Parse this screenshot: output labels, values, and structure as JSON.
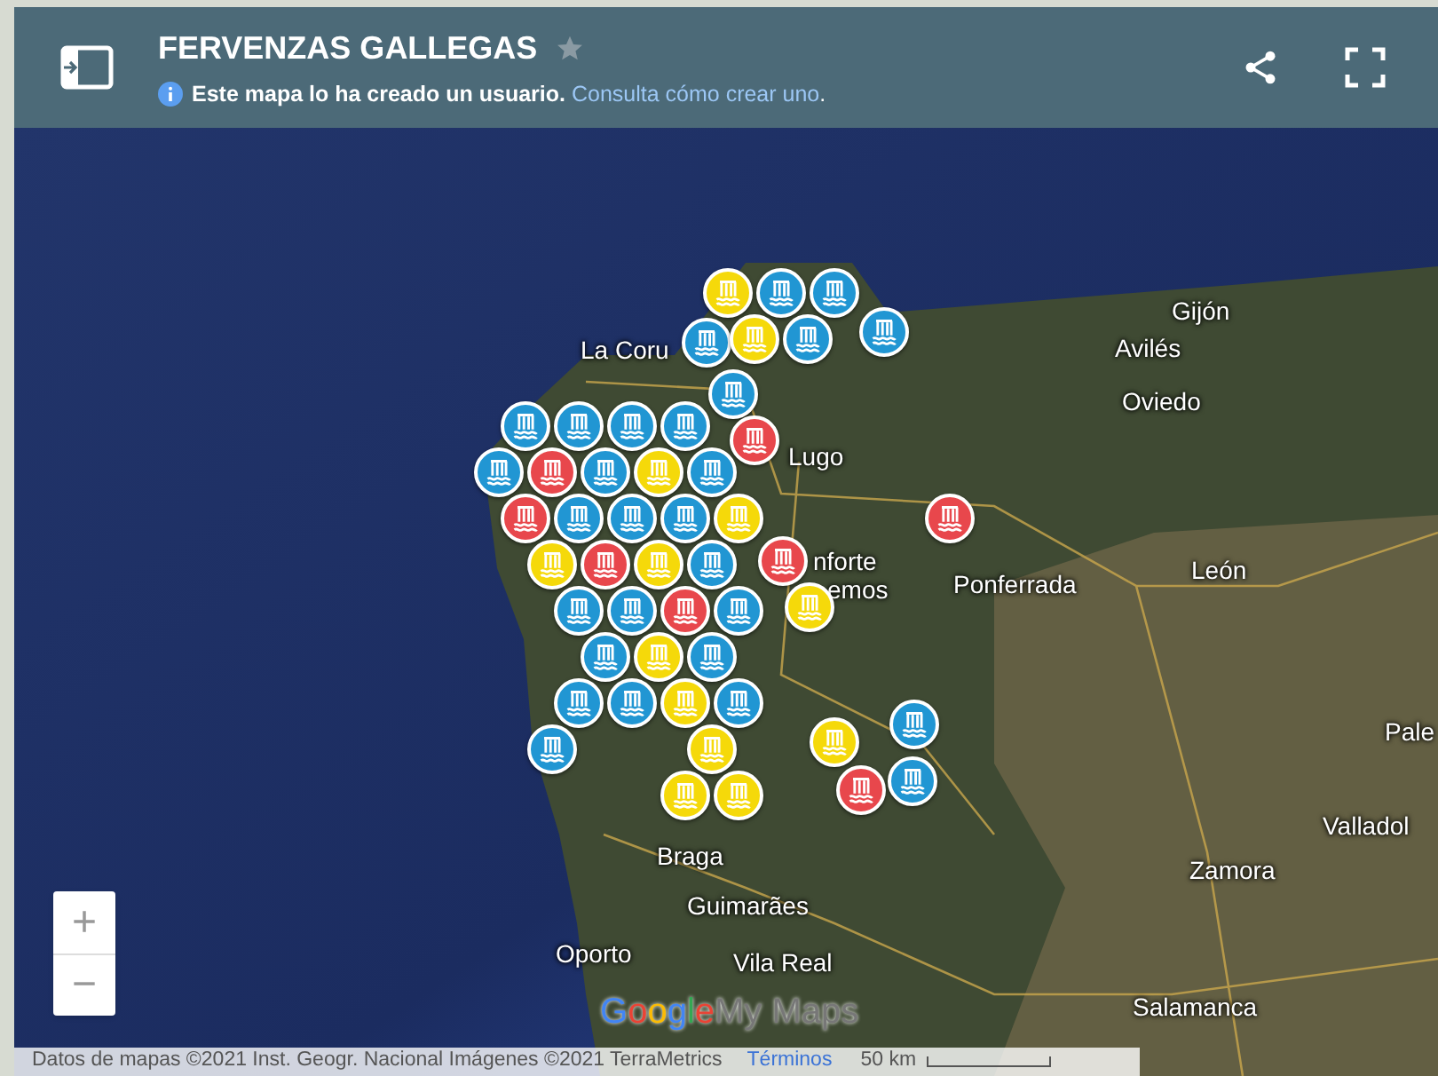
{
  "header": {
    "title": "FERVENZAS GALLEGAS",
    "starred": false,
    "notice": "Este mapa lo ha creado un usuario.",
    "notice_link": "Consulta cómo crear uno",
    "notice_end": "."
  },
  "map_labels": [
    "Gijón",
    "Avilés",
    "Oviedo",
    "La Coru",
    "Lugo",
    "nforte",
    "emos",
    "Ponferrada",
    "León",
    "Pale",
    "Valladol",
    "Zamora",
    "Braga",
    "Guimarães",
    "Oporto",
    "Vila Real",
    "Salamanca"
  ],
  "markers": [
    {
      "color": "#f5d90a"
    },
    {
      "color": "#2196d3"
    },
    {
      "color": "#2196d3"
    },
    {
      "color": "#2196d3"
    },
    {
      "color": "#f5d90a"
    },
    {
      "color": "#2196d3"
    },
    {
      "color": "#2196d3"
    },
    {
      "color": "#2196d3"
    },
    {
      "color": "#e8474c"
    },
    {
      "color": "#2196d3"
    },
    {
      "color": "#2196d3"
    },
    {
      "color": "#2196d3"
    },
    {
      "color": "#2196d3"
    },
    {
      "color": "#2196d3"
    },
    {
      "color": "#e8474c"
    },
    {
      "color": "#2196d3"
    },
    {
      "color": "#f5d90a"
    },
    {
      "color": "#2196d3"
    },
    {
      "color": "#e8474c"
    },
    {
      "color": "#2196d3"
    },
    {
      "color": "#2196d3"
    },
    {
      "color": "#2196d3"
    },
    {
      "color": "#f5d90a"
    },
    {
      "color": "#f5d90a"
    },
    {
      "color": "#e8474c"
    },
    {
      "color": "#f5d90a"
    },
    {
      "color": "#2196d3"
    },
    {
      "color": "#e8474c"
    },
    {
      "color": "#2196d3"
    },
    {
      "color": "#2196d3"
    },
    {
      "color": "#e8474c"
    },
    {
      "color": "#2196d3"
    },
    {
      "color": "#f5d90a"
    },
    {
      "color": "#2196d3"
    },
    {
      "color": "#f5d90a"
    },
    {
      "color": "#2196d3"
    },
    {
      "color": "#2196d3"
    },
    {
      "color": "#2196d3"
    },
    {
      "color": "#f5d90a"
    },
    {
      "color": "#2196d3"
    },
    {
      "color": "#2196d3"
    },
    {
      "color": "#f5d90a"
    },
    {
      "color": "#f5d90a"
    },
    {
      "color": "#f5d90a"
    },
    {
      "color": "#f5d90a"
    },
    {
      "color": "#e8474c"
    },
    {
      "color": "#2196d3"
    },
    {
      "color": "#2196d3"
    },
    {
      "color": "#e8474c"
    }
  ],
  "zoom_controls": [
    "+",
    "−"
  ],
  "logo": {
    "brand": "Google",
    "product": "My Maps"
  },
  "attribution": {
    "text": "Datos de mapas ©2021 Inst. Geogr. Nacional Imágenes ©2021 TerraMetrics",
    "terms": "Términos",
    "scale": "50 km"
  }
}
